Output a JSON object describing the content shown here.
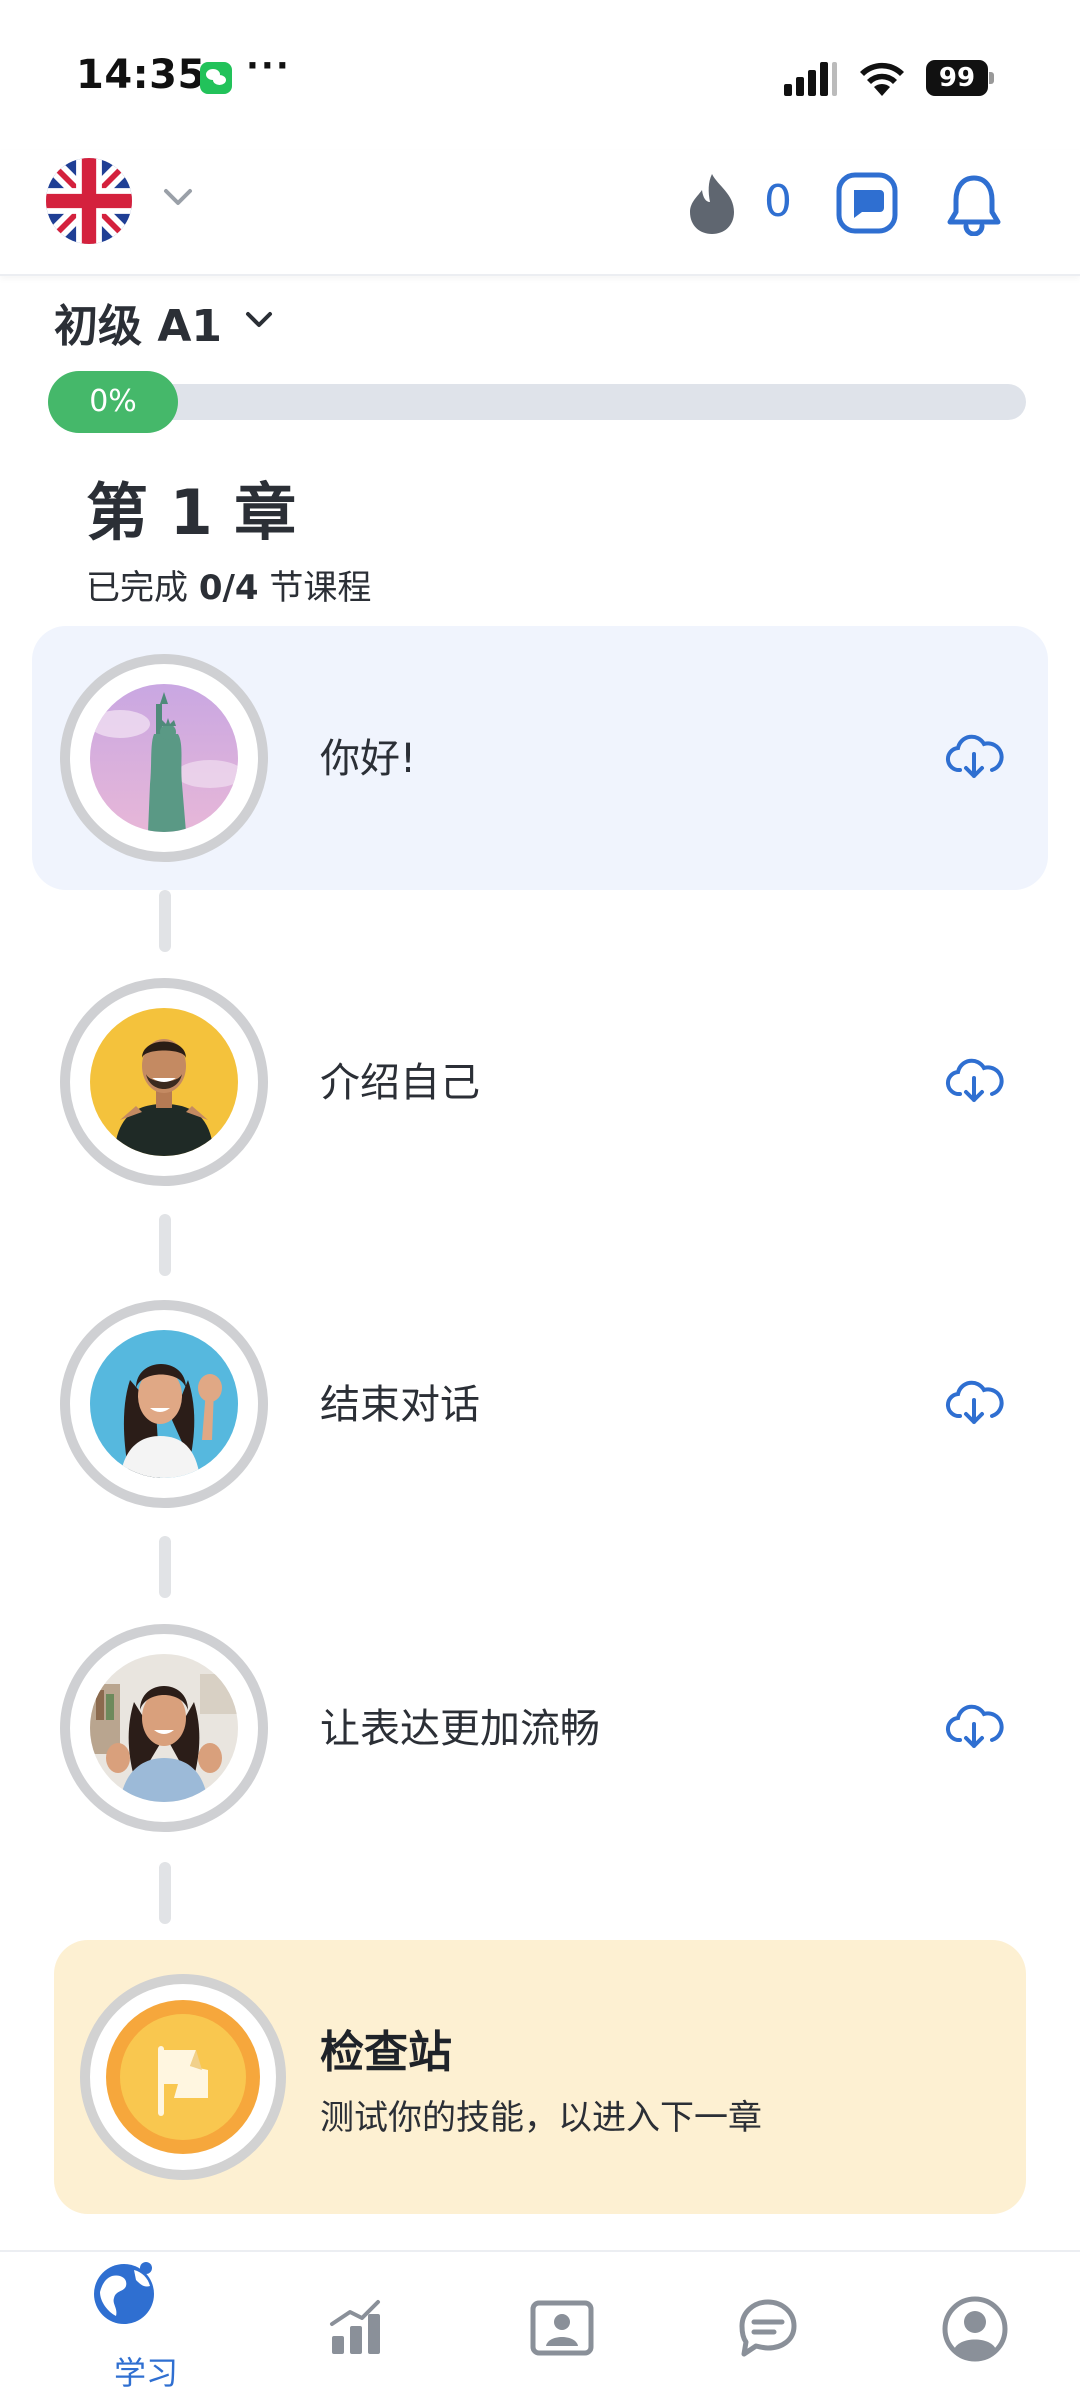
{
  "status_bar": {
    "time": "14:35",
    "battery": "99",
    "icons": [
      "wechat-icon",
      "more-icon",
      "signal-icon",
      "wifi-icon",
      "battery-icon"
    ]
  },
  "header": {
    "language_flag": "uk-flag",
    "streak_count": "0",
    "icons": [
      "chevron-down-icon",
      "flame-icon",
      "chat-icon",
      "bell-icon"
    ]
  },
  "level": {
    "label": "初级 A1",
    "progress_text": "0%",
    "progress_fraction": 0
  },
  "chapter": {
    "title": "第 1 章",
    "subtitle_prefix": "已完成 ",
    "subtitle_count": "0/4",
    "subtitle_suffix": " 节课程"
  },
  "lessons": [
    {
      "title": "你好!",
      "highlighted": true
    },
    {
      "title": "介绍自己",
      "highlighted": false
    },
    {
      "title": "结束对话",
      "highlighted": false
    },
    {
      "title": "让表达更加流畅",
      "highlighted": false
    }
  ],
  "checkpoint": {
    "title": "检查站",
    "subtitle": "测试你的技能，以进入下一章"
  },
  "bottom_nav": {
    "items": [
      {
        "id": "learn",
        "label": "学习",
        "icon": "globe-icon",
        "active": true
      },
      {
        "id": "progress",
        "label": "",
        "icon": "bar-chart-icon",
        "active": false
      },
      {
        "id": "profile-card",
        "label": "",
        "icon": "id-card-icon",
        "active": false
      },
      {
        "id": "community",
        "label": "",
        "icon": "chat-bubbles-icon",
        "active": false
      },
      {
        "id": "account",
        "label": "",
        "icon": "user-icon",
        "active": false
      }
    ]
  },
  "colors": {
    "accent": "#2f6fd1",
    "progress_green": "#45b86a",
    "highlight_bg": "#f0f4fd",
    "checkpoint_bg": "#fdf0d2"
  }
}
